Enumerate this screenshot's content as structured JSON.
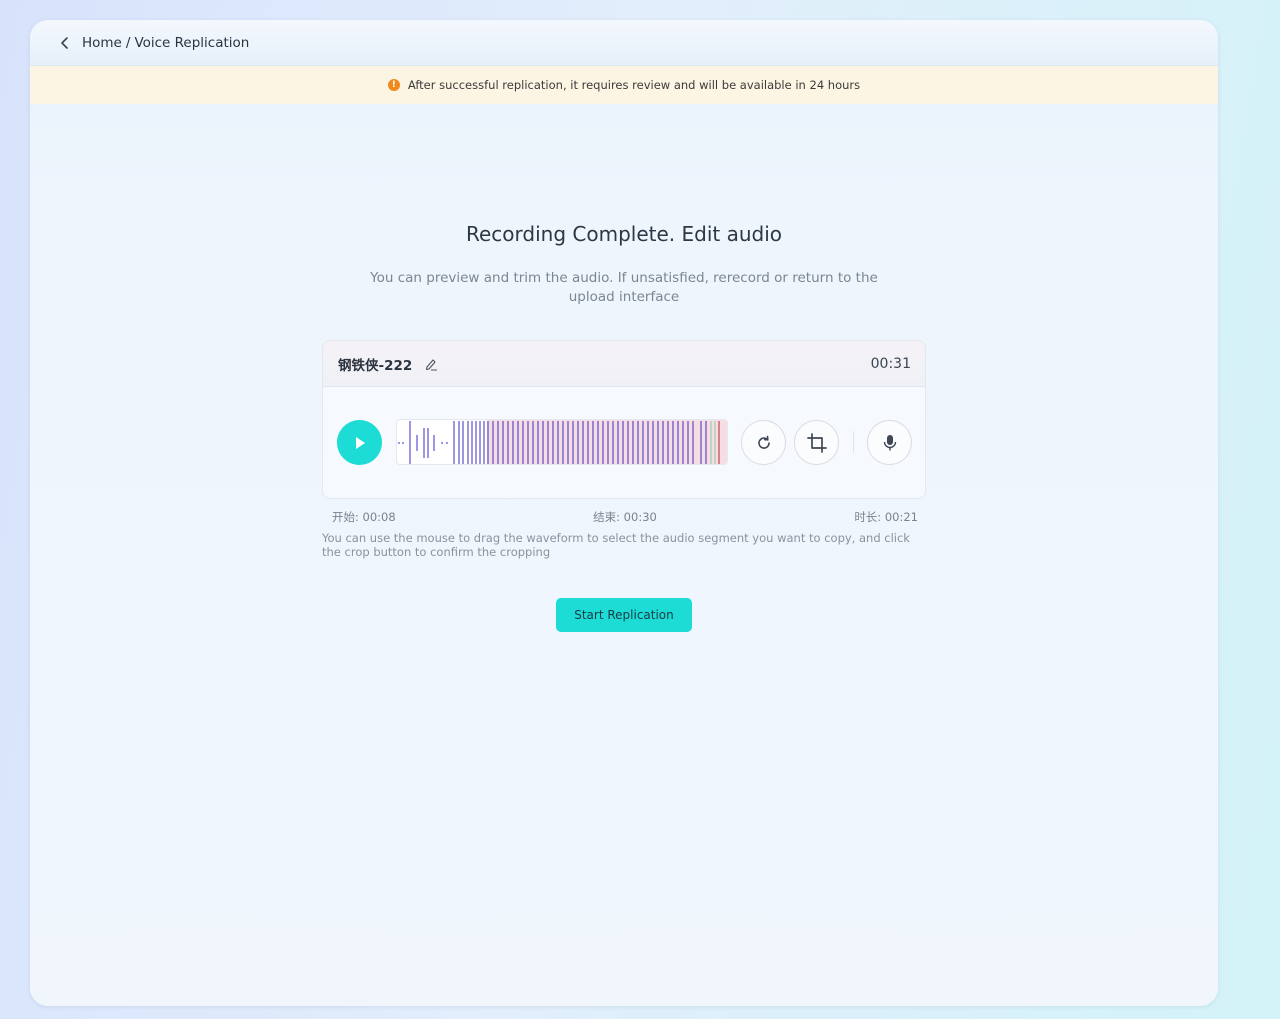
{
  "breadcrumb": {
    "home": "Home",
    "separator": "/",
    "current": "Voice Replication"
  },
  "notice": {
    "text": "After successful replication, it requires review and will be available in 24 hours",
    "icon": "warning-icon",
    "color": "#f08a1c"
  },
  "main": {
    "title": "Recording Complete. Edit audio",
    "subtitle": "You can preview and trim the audio. If unsatisfied, rerecord or return to the upload interface"
  },
  "audio": {
    "name": "钢铁侠-222",
    "duration": "00:31",
    "start": "开始: 00:08",
    "end": "结束: 00:30",
    "length": "时长: 00:21",
    "hint": "You can use the mouse to drag the waveform to select the audio segment you want to copy, and click the crop button to confirm the cropping"
  },
  "actions": {
    "start_label": "Start Replication"
  },
  "colors": {
    "accent": "#1ddcd6",
    "wave": "#3a2fc4",
    "selection": "#f6dde4"
  }
}
